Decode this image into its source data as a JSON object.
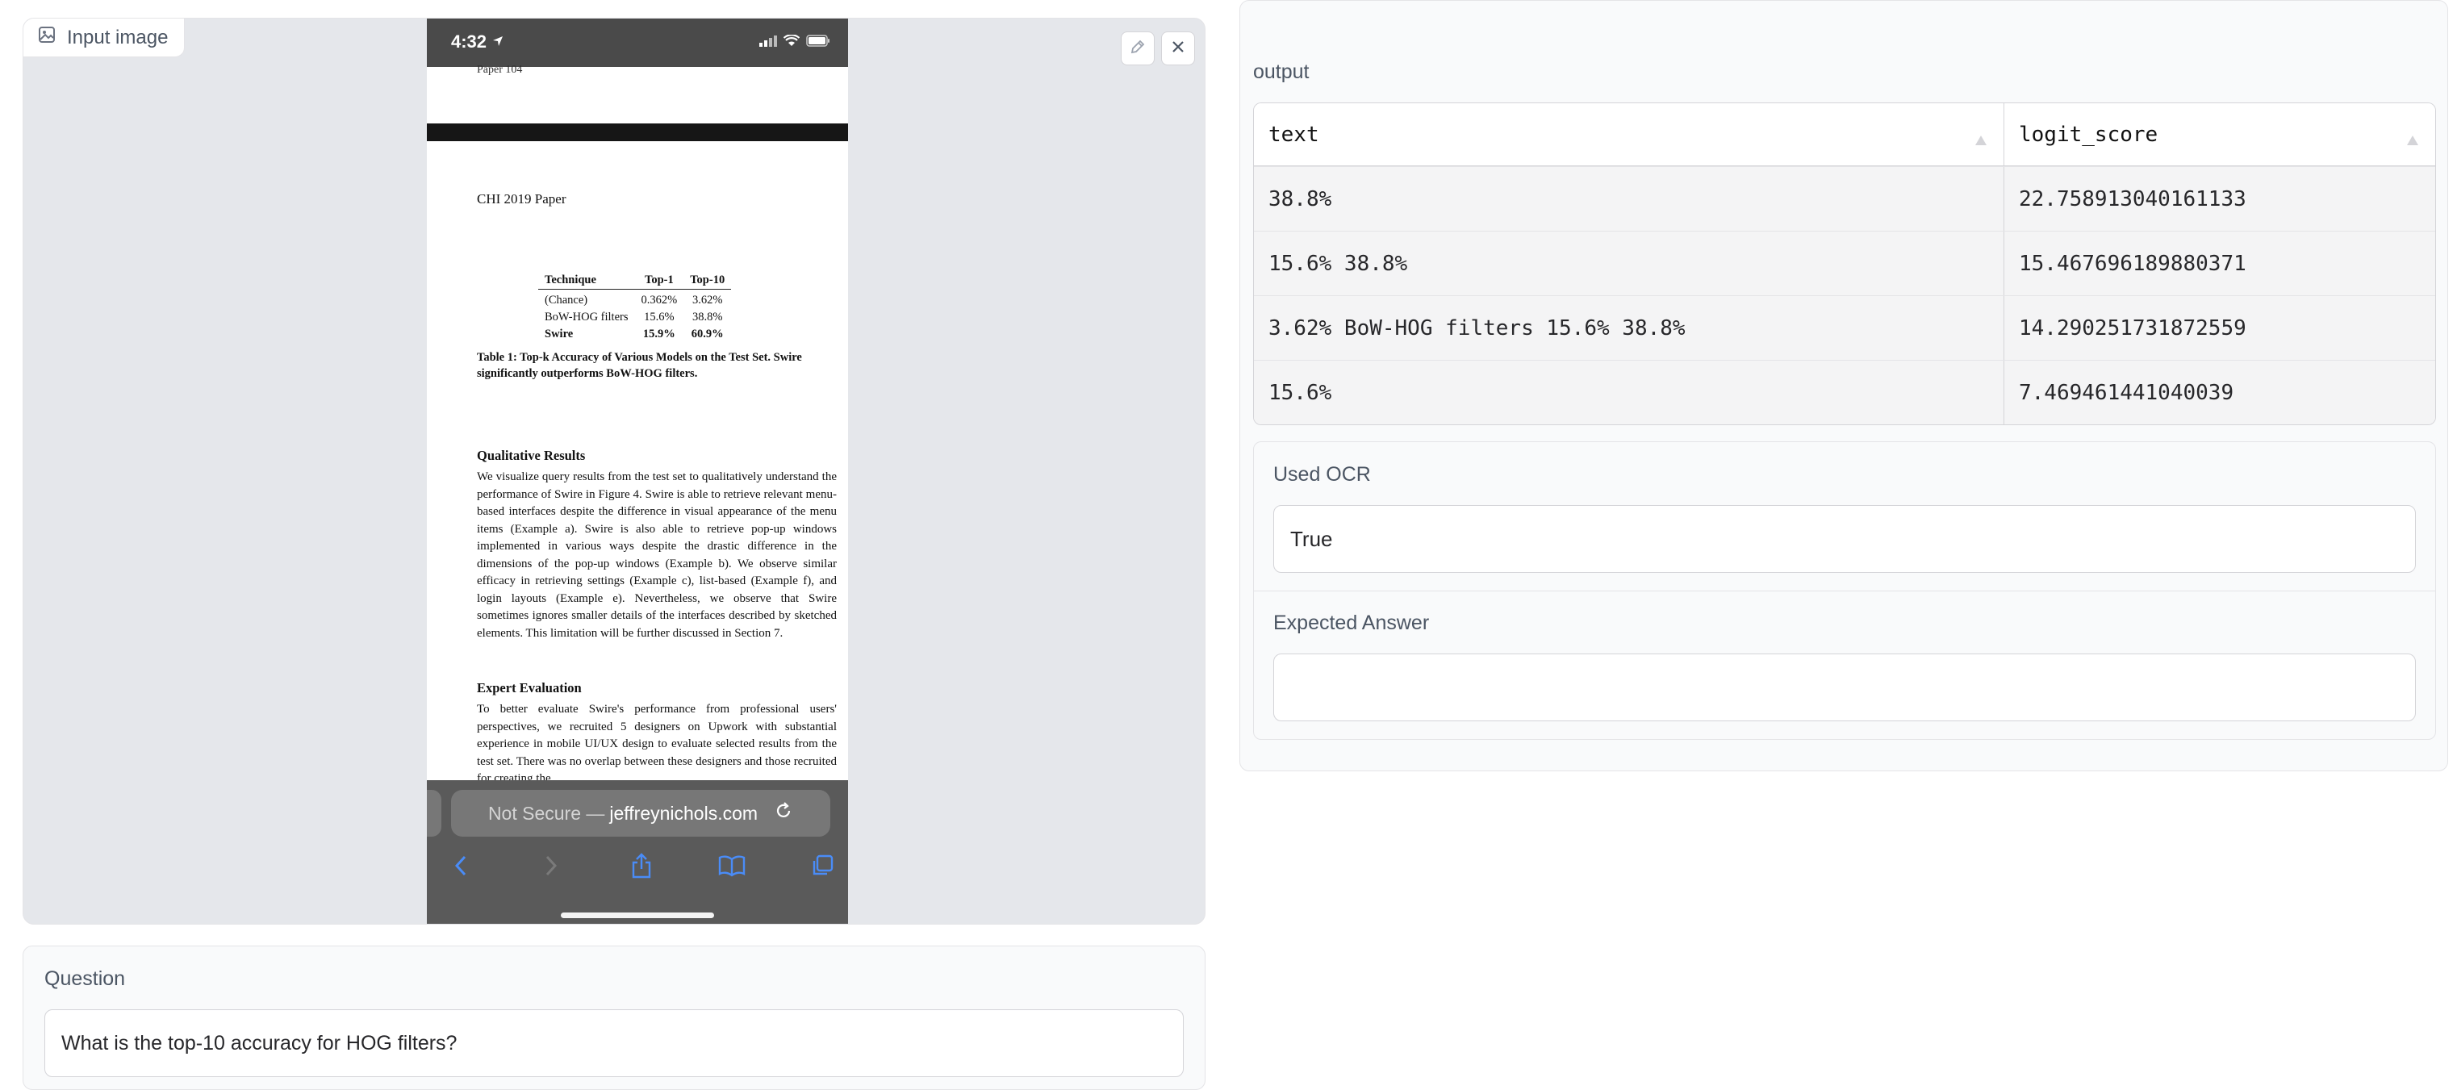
{
  "input_panel": {
    "label": "Input image"
  },
  "phone": {
    "status_time": "4:32",
    "paper_tag": "Paper 104",
    "chi_header": "CHI 2019 Paper",
    "table": {
      "headers": [
        "Technique",
        "Top-1",
        "Top-10"
      ],
      "rows": [
        [
          "(Chance)",
          "0.362%",
          "3.62%"
        ],
        [
          "BoW-HOG filters",
          "15.6%",
          "38.8%"
        ],
        [
          "Swire",
          "15.9%",
          "60.9%"
        ]
      ]
    },
    "caption": "Table 1: Top-k Accuracy of Various Models on the Test Set. Swire significantly outperforms BoW-HOG filters.",
    "section1_title": "Qualitative Results",
    "section1_body": "We visualize query results from the test set to qualitatively understand the performance of Swire in Figure 4. Swire is able to retrieve relevant menu-based interfaces despite the difference in visual appearance of the menu items (Example a). Swire is also able to retrieve pop-up windows implemented in various ways despite the drastic difference in the dimensions of the pop-up windows (Example b). We observe similar efficacy in retrieving settings (Example c), list-based (Example f), and login layouts (Example e). Nevertheless, we observe that Swire sometimes ignores smaller details of the interfaces described by sketched elements. This limitation will be further discussed in Section 7.",
    "section2_title": "Expert Evaluation",
    "section2_body": "To better evaluate Swire's performance from professional users' perspectives, we recruited 5 designers on Upwork with substantial experience in mobile UI/UX design to evaluate selected results from the test set. There was no overlap between these designers and those recruited for creating the",
    "url_prefix": "Not Secure —",
    "url_host": "jeffreynichols.com"
  },
  "question": {
    "label": "Question",
    "value": "What is the top-10 accuracy  for HOG filters?"
  },
  "output": {
    "label": "output",
    "columns": [
      "text",
      "logit_score"
    ],
    "rows": [
      [
        "38.8%",
        "22.758913040161133"
      ],
      [
        "15.6% 38.8%",
        "15.467696189880371"
      ],
      [
        "3.62% BoW-HOG filters 15.6% 38.8%",
        "14.290251731872559"
      ],
      [
        "15.6%",
        "7.469461441040039"
      ]
    ]
  },
  "used_ocr": {
    "label": "Used OCR",
    "value": "True"
  },
  "expected_answer": {
    "label": "Expected Answer",
    "value": ""
  },
  "icons": [
    "image-icon",
    "pencil-icon",
    "close-icon",
    "location-arrow-icon",
    "signal-icon",
    "wifi-icon",
    "battery-icon",
    "reload-icon",
    "back-icon",
    "forward-icon",
    "share-icon",
    "bookmarks-icon",
    "tabs-icon",
    "sort-icon"
  ]
}
